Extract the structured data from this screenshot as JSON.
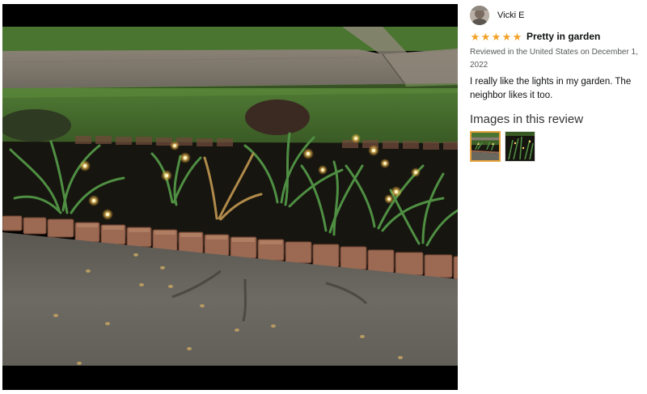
{
  "review": {
    "reviewer_name": "Vicki E",
    "rating": 5,
    "rating_max": 5,
    "title": "Pretty in garden",
    "meta": "Reviewed in the United States on December 1, 2022",
    "body": "I really like the lights in my garden. The neighbor likes it too.",
    "images_heading": "Images in this review",
    "selected_image": 0
  },
  "colors": {
    "star": "#f2a125",
    "selected_border": "#e7a33e",
    "meta_text": "#565959"
  }
}
